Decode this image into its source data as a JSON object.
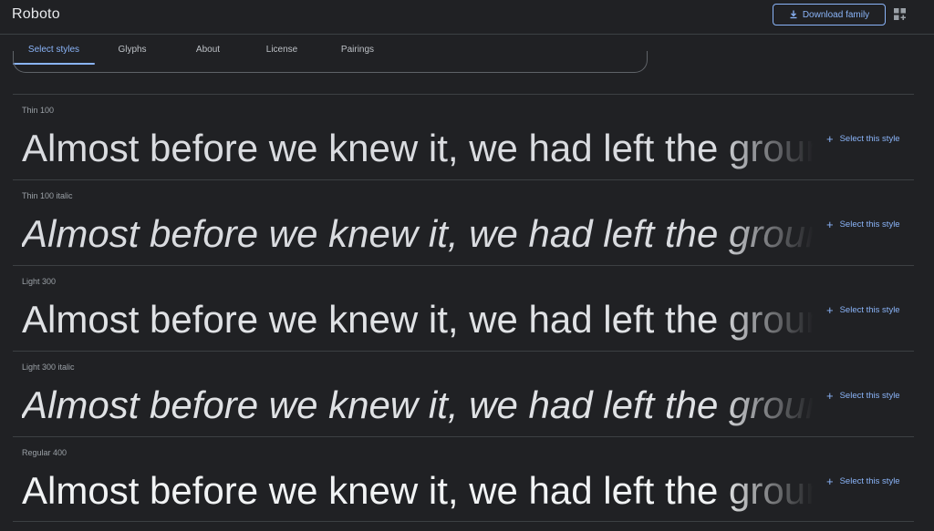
{
  "header": {
    "family_title": "Roboto",
    "download_label": "Download family"
  },
  "tabs": [
    {
      "label": "Select styles",
      "active": true
    },
    {
      "label": "Glyphs",
      "active": false
    },
    {
      "label": "About",
      "active": false
    },
    {
      "label": "License",
      "active": false
    },
    {
      "label": "Pairings",
      "active": false
    }
  ],
  "sample_text": "Almost before we knew it, we had left the ground.",
  "styles": [
    {
      "name": "Thin 100",
      "select_label": "Select this style"
    },
    {
      "name": "Thin 100 italic",
      "select_label": "Select this style"
    },
    {
      "name": "Light 300",
      "select_label": "Select this style"
    },
    {
      "name": "Light 300 italic",
      "select_label": "Select this style"
    },
    {
      "name": "Regular 400",
      "select_label": "Select this style"
    }
  ],
  "colors": {
    "background": "#202124",
    "accent": "#8ab4f8",
    "divider": "#3c4043"
  }
}
